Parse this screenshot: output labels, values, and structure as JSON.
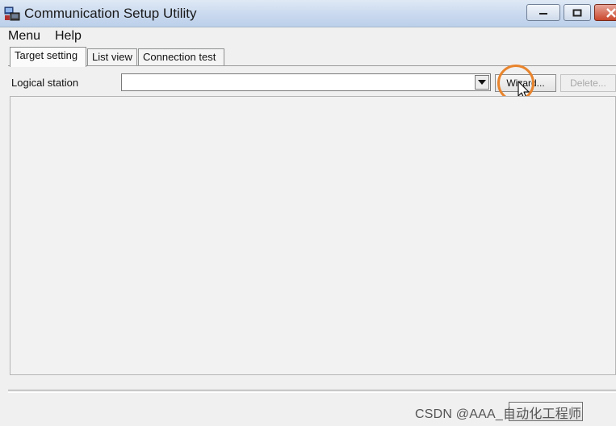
{
  "window": {
    "title": "Communication Setup Utility",
    "accent": "#bcd0ea"
  },
  "menubar": {
    "items": [
      "Menu",
      "Help"
    ]
  },
  "tabs": [
    {
      "label": "Target setting",
      "active": true
    },
    {
      "label": "List view",
      "active": false
    },
    {
      "label": "Connection test",
      "active": false
    }
  ],
  "logical_station": {
    "label": "Logical station",
    "value": ""
  },
  "buttons": {
    "wizard_label": "Wizard...",
    "delete_label": "Delete..."
  },
  "highlight_color": "#e8842d",
  "watermark": "CSDN @AAA_自动化工程师"
}
